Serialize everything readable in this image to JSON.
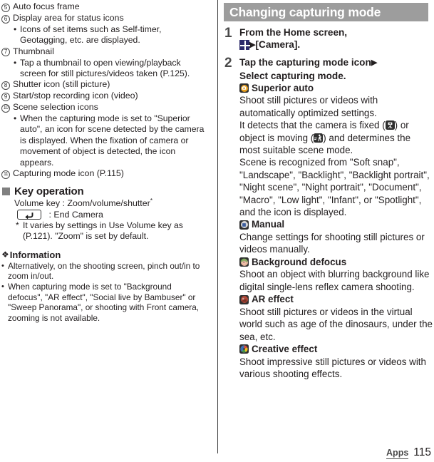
{
  "page": {
    "footer_label": "Apps",
    "page_number": "115"
  },
  "left": {
    "numbered_items": [
      {
        "num": "5",
        "text": "Auto focus frame",
        "bullets": []
      },
      {
        "num": "6",
        "text": "Display area for status icons",
        "bullets": [
          "Icons of set items such as Self-timer, Geotagging, etc. are displayed."
        ]
      },
      {
        "num": "7",
        "text": "Thumbnail",
        "bullets": [
          "Tap a thumbnail to open viewing/playback screen for still pictures/videos taken (P.125)."
        ]
      },
      {
        "num": "8",
        "text": "Shutter icon (still picture)",
        "bullets": []
      },
      {
        "num": "9",
        "text": "Start/stop recording icon (video)",
        "bullets": []
      },
      {
        "num": "10",
        "text": "Scene selection icons",
        "bullets": [
          "When the capturing mode is set to \"Superior auto\", an icon for scene detected by the camera is displayed. When the fixation of camera or movement of object is detected, the icon appears."
        ]
      },
      {
        "num": "11",
        "text": "Capturing mode icon (P.115)",
        "bullets": []
      }
    ],
    "key_operation": {
      "heading": "Key operation",
      "volume_line": "Volume key : Zoom/volume/shutter",
      "volume_asterisk": "*",
      "back_key_icon": "back-arrow-key-icon",
      "back_key_text": ": End Camera",
      "footnote_marker": "*",
      "footnote_text": "It varies by settings in Use Volume key as (P.121). \"Zoom\" is set by default."
    },
    "information": {
      "glyph": "❖",
      "heading": "Information",
      "bullets": [
        "Alternatively, on the shooting screen, pinch out/in to zoom in/out.",
        "When capturing mode is set to \"Background defocus\", \"AR effect\", \"Social live by Bambuser\" or \"Sweep Panorama\", or shooting with Front camera, zooming is not available."
      ]
    }
  },
  "right": {
    "section_title": "Changing capturing mode",
    "steps": [
      {
        "number": "1",
        "line1": "From the Home screen,",
        "icon": "app-grid-icon",
        "arrow": "▶",
        "line2": "[Camera]."
      },
      {
        "number": "2",
        "line1": "Tap the capturing mode icon",
        "arrow": "▶",
        "line2": "Select capturing mode."
      }
    ],
    "modes": [
      {
        "icon": "superior-auto-icon",
        "name": "Superior auto",
        "paragraphs": [
          "Shoot still pictures or videos with automatically optimized settings.",
          "It detects that the camera is fixed ( ) or object is moving ( ) and determines the most suitable scene mode.",
          "Scene is recognized from \"Soft snap\", \"Landscape\", \"Backlight\", \"Backlight portrait\", \"Night scene\", \"Night portrait\", \"Document\", \"Macro\", \"Low light\", \"Infant\", or \"Spotlight\", and the icon is displayed."
        ],
        "inline_icons": {
          "fixed": "tripod-fixed-icon",
          "moving": "moving-object-icon"
        }
      },
      {
        "icon": "manual-mode-icon",
        "name": "Manual",
        "paragraphs": [
          "Change settings for shooting still pictures or videos manually."
        ]
      },
      {
        "icon": "background-defocus-icon",
        "name": "Background defocus",
        "paragraphs": [
          "Shoot an object with blurring background like digital single-lens reflex camera shooting."
        ]
      },
      {
        "icon": "ar-effect-icon",
        "name": "AR effect",
        "paragraphs": [
          "Shoot still pictures or videos in the virtual world such as age of the dinosaurs, under the sea, etc."
        ]
      },
      {
        "icon": "creative-effect-icon",
        "name": "Creative effect",
        "paragraphs": [
          "Shoot impressive still pictures or videos with various shooting effects."
        ]
      }
    ]
  },
  "colors": {
    "section_bar": "#9d9d9d",
    "grid_icon": "#2c2a6b",
    "superior_auto": "#e8a020",
    "text": "#231f20"
  }
}
